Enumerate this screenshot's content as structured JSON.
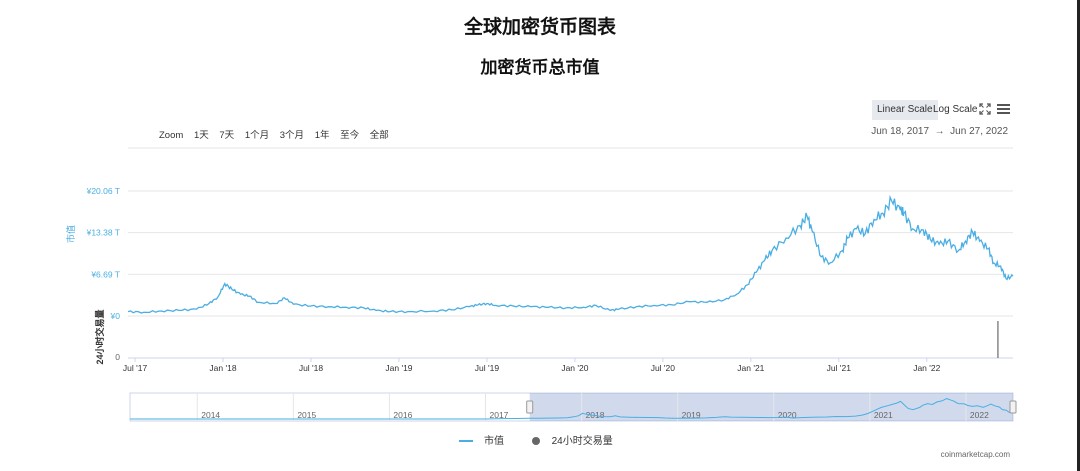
{
  "titles": {
    "main": "全球加密货币图表",
    "sub": "加密货币总市值"
  },
  "controls": {
    "linear_scale": "Linear Scale",
    "log_scale": "Log Scale",
    "zoom_label": "Zoom",
    "zoom_buttons": [
      "1天",
      "7天",
      "1个月",
      "3个月",
      "1年",
      "至今",
      "全部"
    ],
    "date_from": "Jun 18, 2017",
    "date_arrow": "→",
    "date_to": "Jun 27, 2022",
    "active_scale": "linear"
  },
  "icons": {
    "fullscreen": "fullscreen-icon",
    "menu": "hamburger-menu-icon"
  },
  "chart_data": {
    "type": "line",
    "title": "加密货币总市值",
    "ylabel": "市值",
    "ylabel_volume": "24小时交易量",
    "y_ticks": [
      "¥20.06 T",
      "¥13.38 T",
      "¥6.69 T",
      "¥0"
    ],
    "y_ticks_values": [
      20.06,
      13.38,
      6.69,
      0
    ],
    "volume_tick": "0",
    "ylim": [
      0,
      21
    ],
    "x_tick_labels": [
      "Jul '17",
      "Jan '18",
      "Jul '18",
      "Jan '19",
      "Jul '19",
      "Jan '20",
      "Jul '20",
      "Jan '21",
      "Jul '21",
      "Jan '22"
    ],
    "x_ticks_years": [
      2017.5,
      2018.0,
      2018.5,
      2019.0,
      2019.5,
      2020.0,
      2020.5,
      2021.0,
      2021.5,
      2022.0
    ],
    "xlim": [
      2017.46,
      2022.49
    ],
    "series": [
      {
        "name": "市值",
        "color": "#4aaee3",
        "x": [
          2017.46,
          2017.55,
          2017.65,
          2017.75,
          2017.85,
          2017.92,
          2017.97,
          2018.01,
          2018.05,
          2018.1,
          2018.15,
          2018.2,
          2018.3,
          2018.35,
          2018.4,
          2018.5,
          2018.6,
          2018.7,
          2018.8,
          2018.87,
          2018.95,
          2019.05,
          2019.2,
          2019.3,
          2019.4,
          2019.45,
          2019.5,
          2019.55,
          2019.65,
          2019.75,
          2019.85,
          2019.95,
          2020.05,
          2020.12,
          2020.2,
          2020.25,
          2020.35,
          2020.45,
          2020.55,
          2020.65,
          2020.75,
          2020.85,
          2020.92,
          2020.98,
          2021.03,
          2021.08,
          2021.12,
          2021.2,
          2021.28,
          2021.32,
          2021.35,
          2021.4,
          2021.45,
          2021.52,
          2021.55,
          2021.6,
          2021.65,
          2021.7,
          2021.75,
          2021.8,
          2021.85,
          2021.87,
          2021.92,
          2021.98,
          2022.02,
          2022.07,
          2022.12,
          2022.18,
          2022.22,
          2022.26,
          2022.3,
          2022.35,
          2022.38,
          2022.42,
          2022.45,
          2022.49
        ],
        "values": [
          0.7,
          0.6,
          0.8,
          0.9,
          1.1,
          2.0,
          3.0,
          5.2,
          4.3,
          3.5,
          3.2,
          2.2,
          2.0,
          2.9,
          1.9,
          1.6,
          1.5,
          1.4,
          1.3,
          0.9,
          0.7,
          0.7,
          0.8,
          1.0,
          1.5,
          1.8,
          2.0,
          1.7,
          1.6,
          1.5,
          1.4,
          1.3,
          1.4,
          1.7,
          0.9,
          1.1,
          1.5,
          1.7,
          1.8,
          2.3,
          2.2,
          2.6,
          3.5,
          5.0,
          7.0,
          9.0,
          10.5,
          12.5,
          14.5,
          16.0,
          13.5,
          9.5,
          8.5,
          10.5,
          12.5,
          14.0,
          13.2,
          15.5,
          16.5,
          18.5,
          17.0,
          16.5,
          14.0,
          13.8,
          12.3,
          11.5,
          12.0,
          10.5,
          12.0,
          13.5,
          12.0,
          10.8,
          8.5,
          8.0,
          6.0,
          6.4
        ]
      }
    ],
    "volume_series": {
      "name": "24小时交易量",
      "color": "#666666"
    },
    "legend": [
      "市值",
      "24小时交易量"
    ],
    "legend_position": "bottom-center",
    "grid": true,
    "navigator": {
      "year_labels": [
        "2014",
        "2015",
        "2016",
        "2017",
        "2018",
        "2019",
        "2020",
        "2021",
        "2022"
      ],
      "year_values": [
        2014,
        2015,
        2016,
        2017,
        2018,
        2019,
        2020,
        2021,
        2022
      ],
      "range": [
        2013.3,
        2022.49
      ],
      "selected": [
        2017.46,
        2022.49
      ]
    }
  },
  "footer": "coinmarketcap.com"
}
